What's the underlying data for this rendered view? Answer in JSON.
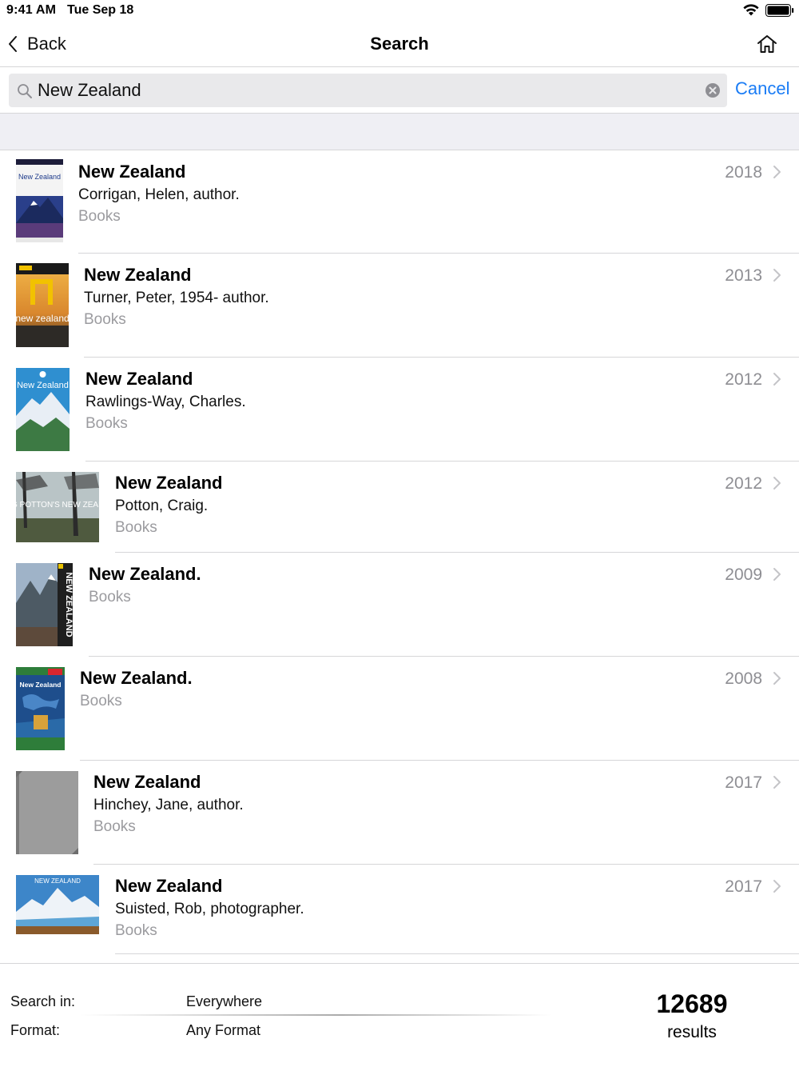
{
  "status_bar": {
    "time": "9:41 AM",
    "date": "Tue Sep 18"
  },
  "nav": {
    "back_label": "Back",
    "title": "Search"
  },
  "search": {
    "query": "New Zealand",
    "placeholder": "",
    "cancel_label": "Cancel"
  },
  "results": [
    {
      "title": "New Zealand",
      "author": "Corrigan, Helen, author.",
      "format": "Books",
      "year": "2018",
      "cover_text": "New Zealand"
    },
    {
      "title": "New Zealand",
      "author": "Turner, Peter, 1954- author.",
      "format": "Books",
      "year": "2013",
      "cover_text": "new zealand"
    },
    {
      "title": "New Zealand",
      "author": "Rawlings-Way, Charles.",
      "format": "Books",
      "year": "2012",
      "cover_text": "New Zealand"
    },
    {
      "title": "New Zealand",
      "author": "Potton, Craig.",
      "format": "Books",
      "year": "2012",
      "cover_text": "CRAIG POTTON'S NEW ZEALAND"
    },
    {
      "title": "New Zealand.",
      "author": "",
      "format": "Books",
      "year": "2009",
      "cover_text": "NEW ZEALAND"
    },
    {
      "title": "New Zealand.",
      "author": "",
      "format": "Books",
      "year": "2008",
      "cover_text": "New Zealand"
    },
    {
      "title": "New Zealand",
      "author": "Hinchey, Jane, author.",
      "format": "Books",
      "year": "2017",
      "cover_text": ""
    },
    {
      "title": "New Zealand",
      "author": "Suisted, Rob, photographer.",
      "format": "Books",
      "year": "2017",
      "cover_text": "NEW ZEALAND"
    }
  ],
  "footer": {
    "search_in_label": "Search in:",
    "search_in_value": "Everywhere",
    "format_label": "Format:",
    "format_value": "Any Format",
    "count": "12689",
    "count_label": "results"
  },
  "colors": {
    "accent": "#1a7cf5",
    "secondary_text": "#8e8e93",
    "separator": "#d6d6d8",
    "band": "#efeff4"
  }
}
